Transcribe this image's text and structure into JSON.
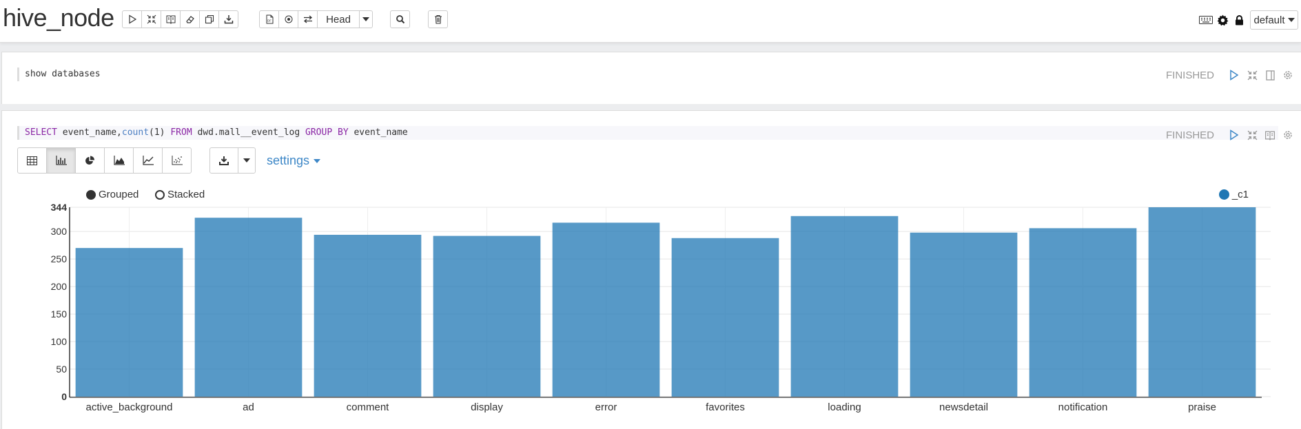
{
  "app": {
    "title": "hive_node"
  },
  "toolbar": {
    "head_label": "Head",
    "default_label": "default"
  },
  "paragraphs": [
    {
      "code": "show databases",
      "status": "FINISHED"
    },
    {
      "code_parts": {
        "k1": "SELECT",
        "t1": " event_name,",
        "f1": "count",
        "t2": "(1) ",
        "k2": "FROM",
        "t3": " dwd.mall__event_log ",
        "k3": "GROUP BY",
        "t4": " event_name"
      },
      "status": "FINISHED"
    }
  ],
  "viz": {
    "settings_label": "settings",
    "grouped_label": "Grouped",
    "stacked_label": "Stacked"
  },
  "colors": {
    "bar": "#1f77b4",
    "link": "#3d87c7",
    "keyword": "#8b27a5",
    "function": "#4a7ec2"
  },
  "icons": {
    "header": [
      "play-icon",
      "collapse-icon",
      "book-icon",
      "eraser-icon",
      "copy-icon",
      "download-icon",
      "pdf-icon",
      "circle-icon",
      "swap-icon",
      "search-icon",
      "trash-icon",
      "keyboard-icon",
      "gear-icon",
      "lock-icon"
    ],
    "viz": [
      "table-icon",
      "bar-chart-icon",
      "pie-chart-icon",
      "area-chart-icon",
      "line-chart-icon",
      "scatter-chart-icon",
      "download-icon"
    ]
  },
  "chart_data": {
    "type": "bar",
    "legend": [
      "_c1"
    ],
    "categories": [
      "active_background",
      "ad",
      "comment",
      "display",
      "error",
      "favorites",
      "loading",
      "newsdetail",
      "notification",
      "praise"
    ],
    "series": [
      {
        "name": "_c1",
        "values": [
          270,
          325,
          294,
          292,
          316,
          288,
          328,
          298,
          306,
          344
        ]
      }
    ],
    "yticks": [
      "0",
      "50",
      "100",
      "150",
      "200",
      "250",
      "300",
      "344"
    ],
    "ylim": [
      0,
      344
    ],
    "grid": true
  }
}
